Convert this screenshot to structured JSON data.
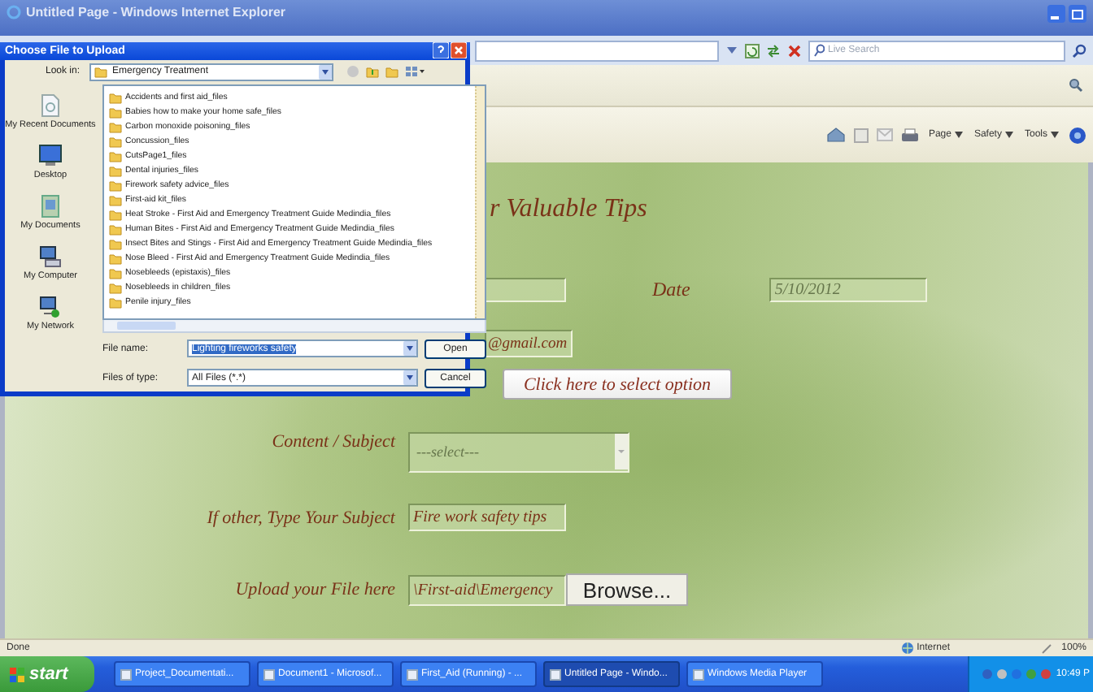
{
  "window": {
    "title": "Untitled Page - Windows Internet Explorer"
  },
  "address_bar": {
    "search_placeholder": "Live Search"
  },
  "command_bar": [
    "Page",
    "Safety",
    "Tools"
  ],
  "page": {
    "heading": "r Valuable Tips",
    "date_label": "Date",
    "date_value": "5/10/2012",
    "email_value": "@gmail.com",
    "option_button": "Click here to select option",
    "rows": [
      {
        "kind": "select",
        "label": "Content / Subject",
        "placeholder": "---select---"
      },
      {
        "kind": "text",
        "label": "If other, Type Your Subject",
        "value": "Fire work safety tips"
      },
      {
        "kind": "file",
        "label": "Upload your File here",
        "value": "\\First-aid\\Emergency",
        "button": "Browse..."
      }
    ]
  },
  "dialog": {
    "title": "Choose File to Upload",
    "look_in_label": "Look in:",
    "look_in_value": "Emergency Treatment",
    "places": [
      {
        "kind": "recent",
        "label": "My Recent Documents"
      },
      {
        "kind": "desktop",
        "label": "Desktop"
      },
      {
        "kind": "documents",
        "label": "My Documents"
      },
      {
        "kind": "computer",
        "label": "My Computer"
      },
      {
        "kind": "network",
        "label": "My Network"
      }
    ],
    "files": [
      "Accidents and first aid_files",
      "Babies how to make your home safe_files",
      "Carbon monoxide poisoning_files",
      "Concussion_files",
      "CutsPage1_files",
      "Dental injuries_files",
      "Firework safety advice_files",
      "First-aid kit_files",
      "Heat Stroke - First Aid and Emergency Treatment Guide  Medindia_files",
      "Human Bites - First Aid and Emergency Treatment Guide  Medindia_files",
      "Insect Bites and Stings - First Aid and Emergency Treatment Guide  Medindia_files",
      "Nose Bleed - First Aid and Emergency Treatment Guide  Medindia_files",
      "Nosebleeds (epistaxis)_files",
      "Nosebleeds in children_files",
      "Penile injury_files"
    ],
    "file_name_label": "File name:",
    "file_name_value": "Lighting fireworks safety",
    "file_name_highlighted": true,
    "file_type_label": "Files of type:",
    "file_type_value": "All Files (*.*)",
    "buttons": [
      "Open",
      "Cancel"
    ]
  },
  "status_bar": {
    "text": "Done",
    "zone": "Internet",
    "zoom": "100%"
  },
  "taskbar": {
    "start": "start",
    "items": [
      {
        "label": "Project_Documentati...",
        "selected": false
      },
      {
        "label": "Document1 - Microsof...",
        "selected": false
      },
      {
        "label": "First_Aid (Running) - ...",
        "selected": false
      },
      {
        "label": "Untitled Page - Windo...",
        "selected": true
      },
      {
        "label": "Windows Media Player",
        "selected": false
      }
    ],
    "clock": "10:49 P"
  }
}
